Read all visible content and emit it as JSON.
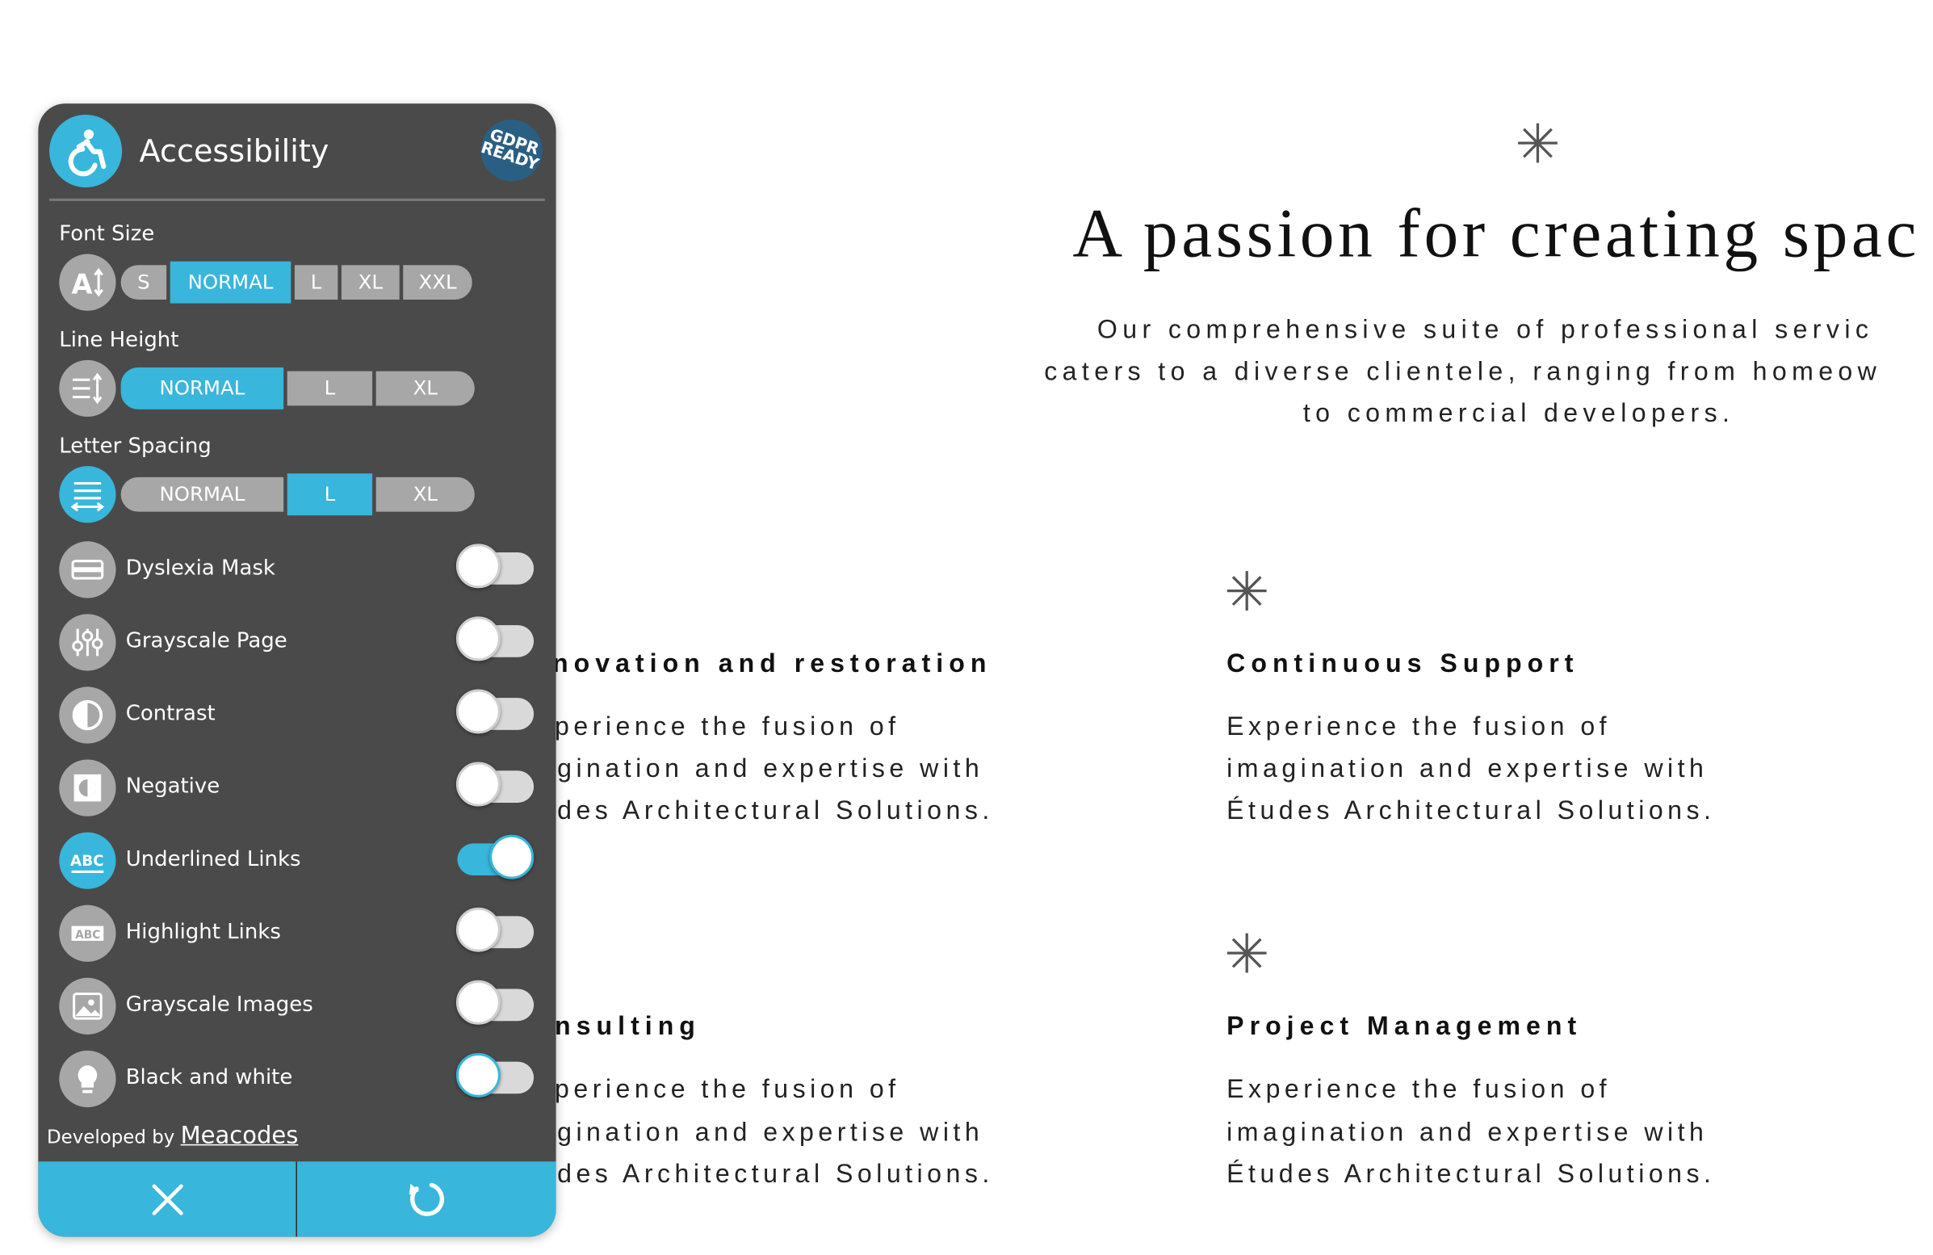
{
  "panel": {
    "title": "Accessibility",
    "badge": "GDPR READY",
    "font_size": {
      "label": "Font Size",
      "options": [
        "S",
        "NORMAL",
        "L",
        "XL",
        "XXL"
      ],
      "selected": "NORMAL"
    },
    "line_height": {
      "label": "Line Height",
      "options": [
        "NORMAL",
        "L",
        "XL"
      ],
      "selected": "NORMAL"
    },
    "letter_spacing": {
      "label": "Letter Spacing",
      "options": [
        "NORMAL",
        "L",
        "XL"
      ],
      "selected": "L"
    },
    "toggles": [
      {
        "label": "Dyslexia Mask",
        "icon": "dyslexia-mask-icon",
        "on": false
      },
      {
        "label": "Grayscale Page",
        "icon": "sliders-icon",
        "on": false
      },
      {
        "label": "Contrast",
        "icon": "contrast-icon",
        "on": false
      },
      {
        "label": "Negative",
        "icon": "negative-icon",
        "on": false
      },
      {
        "label": "Underlined Links",
        "icon": "underline-abc-icon",
        "on": true
      },
      {
        "label": "Highlight Links",
        "icon": "highlight-abc-icon",
        "on": false
      },
      {
        "label": "Grayscale Images",
        "icon": "image-icon",
        "on": false
      },
      {
        "label": "Black and white",
        "icon": "lightbulb-icon",
        "on": false
      }
    ],
    "footer": {
      "developed_by": "Developed by",
      "developer": "Meacodes"
    },
    "colors": {
      "accent": "#38b6db",
      "panel_bg": "#4a4a4a",
      "inactive": "#a7a7a7"
    }
  },
  "page": {
    "hero": {
      "title": "A passion for creating spac",
      "subtitle_lines": [
        "Our comprehensive suite of professional servic",
        "caters to a diverse clientele, ranging from homeow",
        "to commercial developers."
      ]
    },
    "services": [
      {
        "title": "novation and restoration",
        "lines": [
          "perience the fusion of",
          "gination and expertise with",
          "des Architectural Solutions."
        ]
      },
      {
        "title": "Continuous Support",
        "lines": [
          "Experience the fusion of",
          "imagination and expertise with",
          "Études Architectural Solutions."
        ]
      },
      {
        "title": "nsulting",
        "lines": [
          "perience the fusion of",
          "gination and expertise with",
          "des Architectural Solutions."
        ]
      },
      {
        "title": "Project Management",
        "lines": [
          "Experience the fusion of",
          "imagination and expertise with",
          "Études Architectural Solutions."
        ]
      }
    ]
  }
}
